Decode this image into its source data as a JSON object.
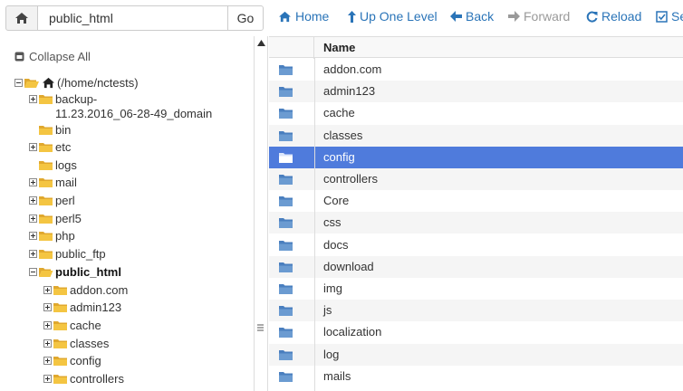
{
  "toolbar": {
    "path_value": "public_html",
    "go_label": "Go",
    "nav": [
      {
        "label": "Home",
        "icon": "home-icon",
        "enabled": true
      },
      {
        "label": "Up One Level",
        "icon": "level-up-icon",
        "enabled": true
      },
      {
        "label": "Back",
        "icon": "back-arrow-icon",
        "enabled": true
      },
      {
        "label": "Forward",
        "icon": "forward-arrow-icon",
        "enabled": false
      },
      {
        "label": "Reload",
        "icon": "reload-icon",
        "enabled": true
      },
      {
        "label": "Se",
        "icon": "select-all-icon",
        "enabled": true
      }
    ]
  },
  "tree": {
    "collapse_label": "Collapse All",
    "root_label": "(/home/nctests)",
    "items": [
      {
        "label": "backup-",
        "label2": "11.23.2016_06-28-49_domain"
      },
      {
        "label": "bin"
      },
      {
        "label": "etc"
      },
      {
        "label": "logs"
      },
      {
        "label": "mail"
      },
      {
        "label": "perl"
      },
      {
        "label": "perl5"
      },
      {
        "label": "php"
      },
      {
        "label": "public_ftp"
      },
      {
        "label": "public_html"
      },
      {
        "label": "addon.com"
      },
      {
        "label": "admin123"
      },
      {
        "label": "cache"
      },
      {
        "label": "classes"
      },
      {
        "label": "config"
      },
      {
        "label": "controllers"
      }
    ]
  },
  "table": {
    "header_name": "Name",
    "selected_index": 4,
    "rows": [
      "addon.com",
      "admin123",
      "cache",
      "classes",
      "config",
      "controllers",
      "Core",
      "css",
      "docs",
      "download",
      "img",
      "js",
      "localization",
      "log",
      "mails"
    ]
  },
  "colors": {
    "link": "#2a74b8",
    "disabled": "#9a9a9a",
    "selected_row": "#4f7bdc",
    "folder_yellow": "#f4c542",
    "folder_blue": "#6b9bd1"
  }
}
